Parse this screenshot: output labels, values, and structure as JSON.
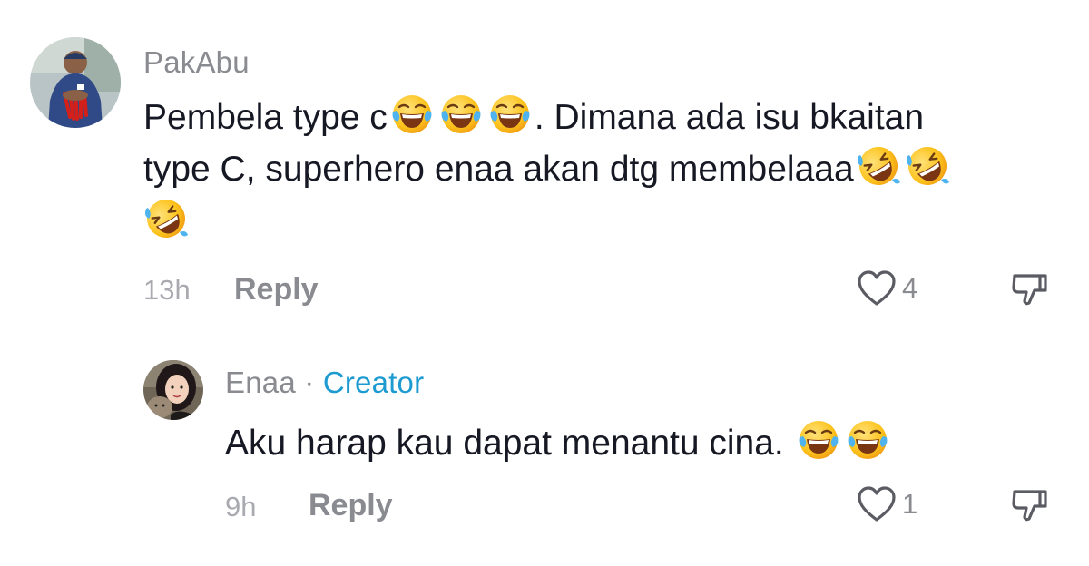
{
  "comments": [
    {
      "username": "PakAbu",
      "line1_text": "Pembela type c",
      "line1_after": ". Dimana ada isu bkaitan",
      "line2_text": "type C, superhero enaa akan dtg membelaaa",
      "time": "13h",
      "reply_label": "Reply",
      "likes": "4",
      "icons": {
        "emoji_line1": "face-with-tears-of-joy",
        "emoji_line2": "rolling-on-the-floor-laughing",
        "like": "heart-outline-icon",
        "dislike": "thumbs-down-icon"
      }
    },
    {
      "username": "Enaa",
      "separator": "·",
      "badge": "Creator",
      "text": "Aku harap kau dapat menantu cina.",
      "time": "9h",
      "reply_label": "Reply",
      "likes": "1",
      "icons": {
        "emoji": "face-with-tears-of-joy",
        "like": "heart-outline-icon",
        "dislike": "thumbs-down-icon"
      }
    }
  ],
  "colors": {
    "text": "#161823",
    "muted": "#8a8b91",
    "creator": "#1d9bd1"
  }
}
